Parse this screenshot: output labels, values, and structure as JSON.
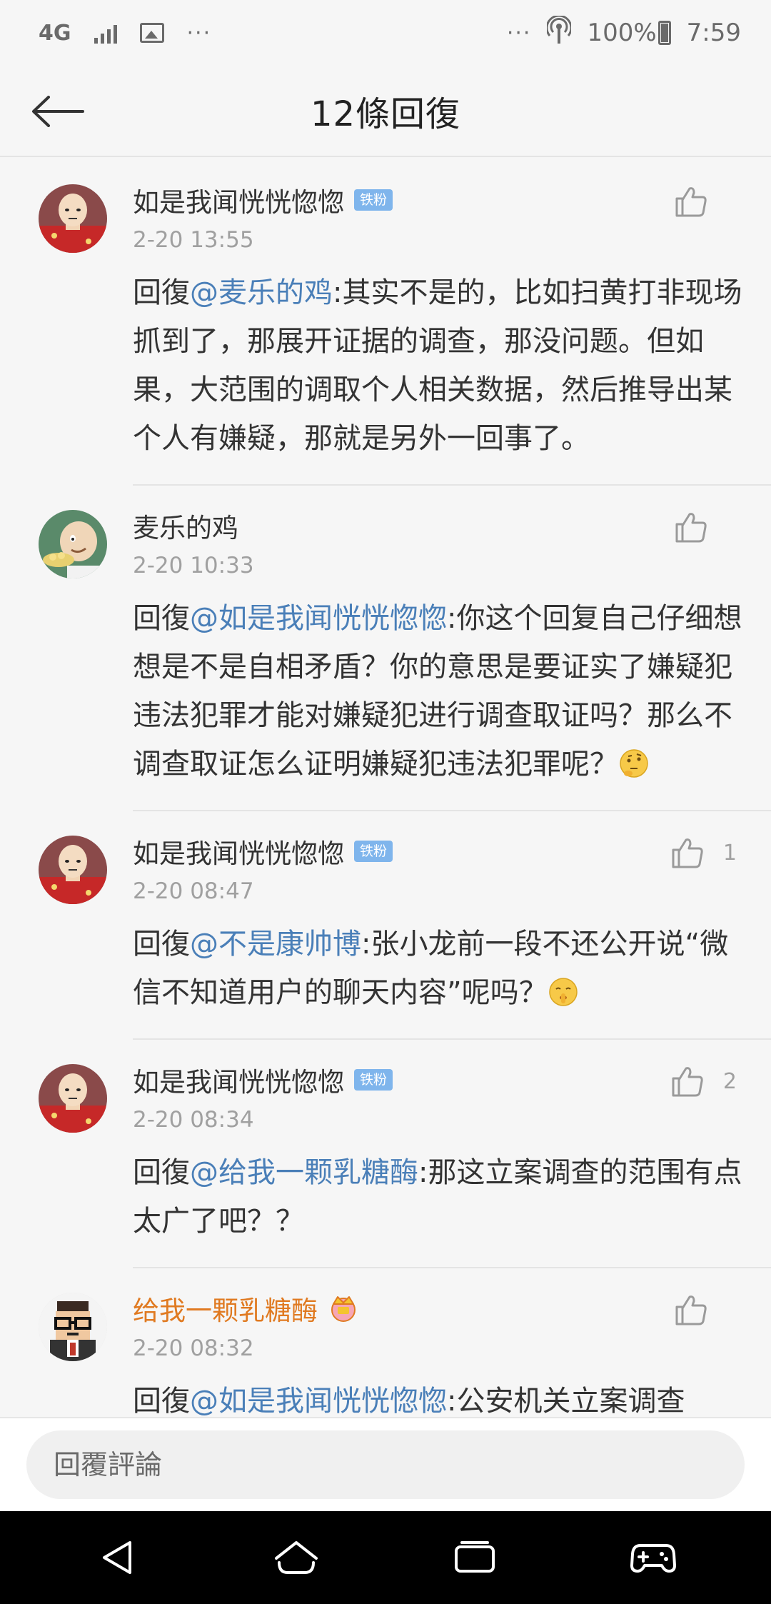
{
  "status_bar": {
    "network": "4G",
    "dots_left": "···",
    "dots_right": "···",
    "battery": "100%",
    "time": "7:59"
  },
  "header": {
    "title": "12條回復"
  },
  "comments": [
    {
      "username": "如是我闻恍恍惚惚",
      "badge": "铁粉",
      "is_vip": false,
      "timestamp": "2-20 13:55",
      "like_count": "",
      "reply_prefix": "回復",
      "mention": "@麦乐的鸡",
      "text": ":其实不是的，比如扫黄打非现场抓到了，那展开证据的调查，那没问题。但如果，大范围的调取个人相关数据，然后推导出某个人有嫌疑，那就是另外一回事了。",
      "emoji": "",
      "avatar": "bald-hero"
    },
    {
      "username": "麦乐的鸡",
      "badge": "",
      "is_vip": false,
      "timestamp": "2-20 10:33",
      "like_count": "",
      "reply_prefix": "回復",
      "mention": "@如是我闻恍恍惚惚",
      "text": ":你这个回复自己仔细想想是不是自相矛盾？你的意思是要证实了嫌疑犯违法犯罪才能对嫌疑犯进行调查取证吗？那么不调查取证怎么证明嫌疑犯违法犯罪呢？",
      "emoji": "thinking-face",
      "avatar": "cartoon-man"
    },
    {
      "username": "如是我闻恍恍惚惚",
      "badge": "铁粉",
      "is_vip": false,
      "timestamp": "2-20 08:47",
      "like_count": "1",
      "reply_prefix": "回復",
      "mention": "@不是康帅博",
      "text": ":张小龙前一段不还公开说“微信不知道用户的聊天内容”呢吗？",
      "emoji": "shushing-face",
      "avatar": "bald-hero"
    },
    {
      "username": "如是我闻恍恍惚惚",
      "badge": "铁粉",
      "is_vip": false,
      "timestamp": "2-20 08:34",
      "like_count": "2",
      "reply_prefix": "回復",
      "mention": "@给我一颗乳糖酶",
      "text": ":那这立案调查的范围有点太广了吧？？",
      "emoji": "",
      "avatar": "bald-hero"
    },
    {
      "username": "给我一颗乳糖酶",
      "badge": "",
      "is_vip": true,
      "timestamp": "2-20 08:32",
      "like_count": "",
      "reply_prefix": "回復",
      "mention": "@如是我闻恍恍惚惚",
      "text": ":公安机关立案调查",
      "emoji": "",
      "avatar": "pixel-man"
    }
  ],
  "reply_bar": {
    "placeholder": "回覆評論"
  },
  "colors": {
    "mention": "#4a7fb8",
    "vip_name": "#e07a21",
    "badge": "#7fb5ec",
    "muted": "#a0a0a0"
  }
}
